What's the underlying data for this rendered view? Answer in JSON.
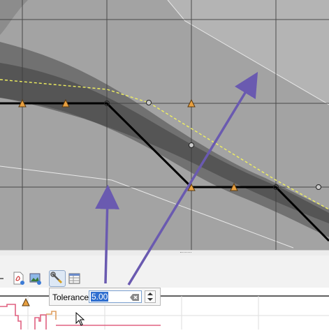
{
  "tolerance": {
    "label": "Tolerance",
    "value": "5.00"
  },
  "icons": {
    "toolbar": [
      "pdf-export-icon",
      "image-export-icon",
      "tolerance-wrench-icon",
      "settings-table-icon"
    ],
    "input": [
      "clear-input-icon",
      "spin-up-icon",
      "spin-down-icon"
    ],
    "map": [
      "vertex-triangle-icon",
      "vertex-circle-icon"
    ],
    "cursor": "mouse-pointer-icon"
  },
  "colors": {
    "profile_line": "#000000",
    "tolerance_line": "#f0f060",
    "annotation_arrow": "#6a5ab0",
    "vertex_marker": "#e8a040",
    "profile_plot": "#e06080",
    "input_selection": "#2f6fd0"
  }
}
